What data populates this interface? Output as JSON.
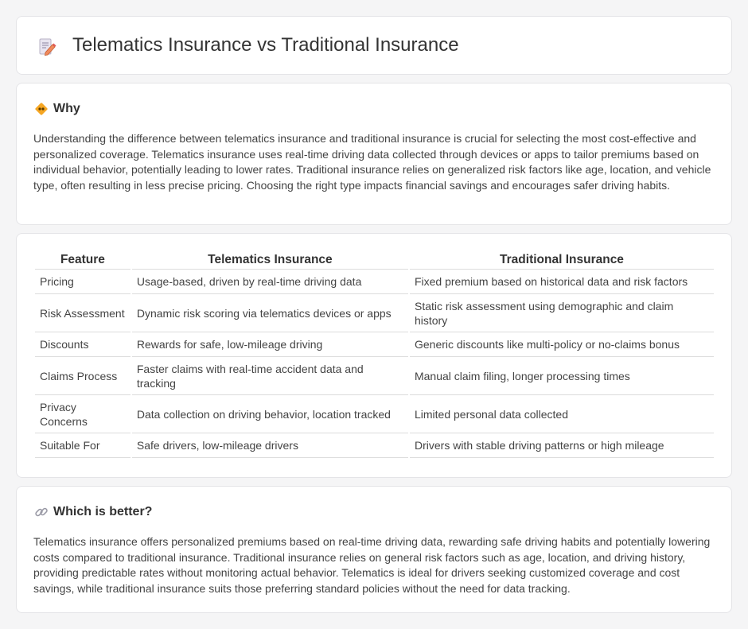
{
  "header": {
    "title": "Telematics Insurance vs Traditional Insurance",
    "icon": "document-pencil-icon"
  },
  "why": {
    "heading": "Why",
    "icon": "diamond-warning-icon",
    "text": "Understanding the difference between telematics insurance and traditional insurance is crucial for selecting the most cost-effective and personalized coverage. Telematics insurance uses real-time driving data collected through devices or apps to tailor premiums based on individual behavior, potentially leading to lower rates. Traditional insurance relies on generalized risk factors like age, location, and vehicle type, often resulting in less precise pricing. Choosing the right type impacts financial savings and encourages safer driving habits."
  },
  "comparison": {
    "headers": [
      "Feature",
      "Telematics Insurance",
      "Traditional Insurance"
    ],
    "rows": [
      {
        "feature": "Pricing",
        "telematics": "Usage-based, driven by real-time driving data",
        "traditional": "Fixed premium based on historical data and risk factors"
      },
      {
        "feature": "Risk Assessment",
        "telematics": "Dynamic risk scoring via telematics devices or apps",
        "traditional": "Static risk assessment using demographic and claim history"
      },
      {
        "feature": "Discounts",
        "telematics": "Rewards for safe, low-mileage driving",
        "traditional": "Generic discounts like multi-policy or no-claims bonus"
      },
      {
        "feature": "Claims Process",
        "telematics": "Faster claims with real-time accident data and tracking",
        "traditional": "Manual claim filing, longer processing times"
      },
      {
        "feature": "Privacy Concerns",
        "telematics": "Data collection on driving behavior, location tracked",
        "traditional": "Limited personal data collected"
      },
      {
        "feature": "Suitable For",
        "telematics": "Safe drivers, low-mileage drivers",
        "traditional": "Drivers with stable driving patterns or high mileage"
      }
    ]
  },
  "better": {
    "heading": "Which is better?",
    "icon": "link-icon",
    "text": "Telematics insurance offers personalized premiums based on real-time driving data, rewarding safe driving habits and potentially lowering costs compared to traditional insurance. Traditional insurance relies on general risk factors such as age, location, and driving history, providing predictable rates without monitoring actual behavior. Telematics is ideal for drivers seeking customized coverage and cost savings, while traditional insurance suits those preferring standard policies without the need for data tracking."
  },
  "colors": {
    "background": "#f5f5f6",
    "card": "#ffffff",
    "accent_orange": "#f5a623",
    "icon_pink": "#e57373"
  }
}
